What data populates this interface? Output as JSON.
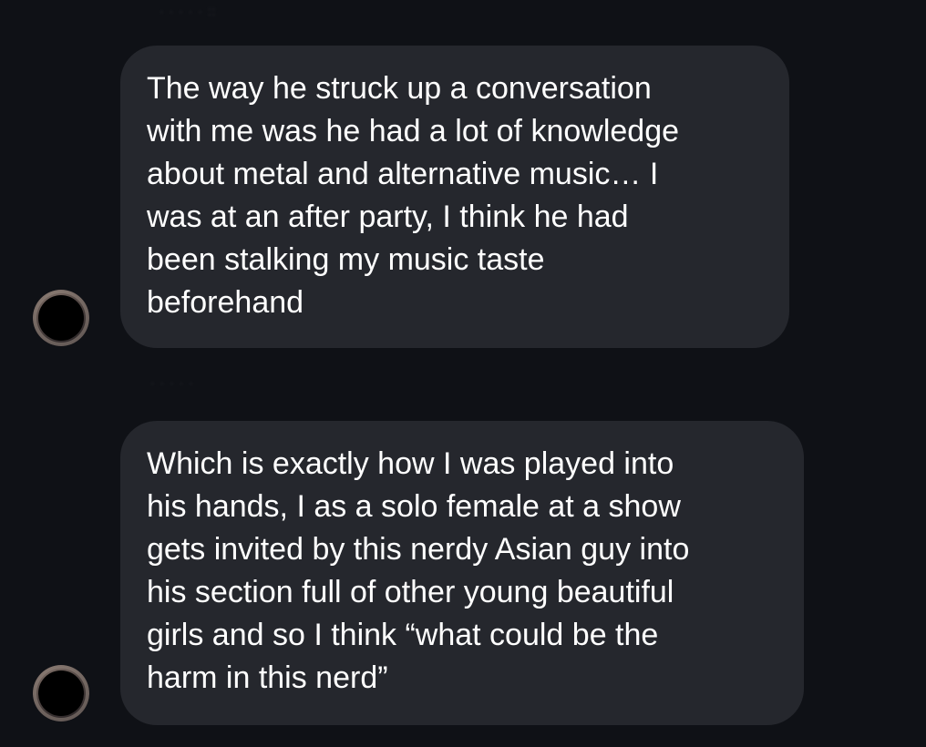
{
  "messages": [
    {
      "text": "The way he struck up a conversation\nwith me was he had a lot of knowledge\nabout metal and alternative music… I\nwas at an after party, I think he had\nbeen stalking my music taste\nbeforehand",
      "avatar": "blurred-profile-photo"
    },
    {
      "text": "Which is exactly how I was played into\nhis hands, I as a solo female at a show\ngets invited by this nerdy Asian guy into\nhis section full of other young beautiful\ngirls and so I think “what could be the\nharm in this nerd”",
      "avatar": "blurred-profile-photo"
    }
  ],
  "colors": {
    "background": "#0f1116",
    "bubble": "#25272d",
    "text": "#ffffff"
  }
}
